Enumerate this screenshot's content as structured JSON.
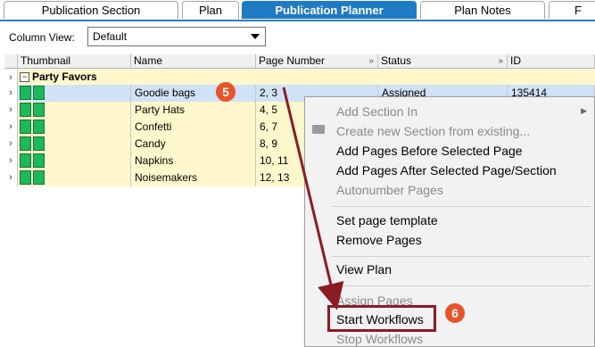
{
  "tabs": [
    {
      "label": "Publication Section",
      "active": false
    },
    {
      "label": "Plan",
      "active": false
    },
    {
      "label": "Publication Planner",
      "active": true
    },
    {
      "label": "Plan Notes",
      "active": false
    },
    {
      "label": "F",
      "active": false
    }
  ],
  "column_view": {
    "label": "Column View:",
    "value": "Default"
  },
  "grid": {
    "headers": [
      "Thumbnail",
      "Name",
      "Page Number",
      "Status",
      "ID"
    ],
    "group": "Party Favors",
    "rows": [
      {
        "name": "Goodie bags",
        "pages": "2, 3",
        "status": "Assigned",
        "id": "135414"
      },
      {
        "name": "Party Hats",
        "pages": "4, 5",
        "status": "",
        "id": ""
      },
      {
        "name": "Confetti",
        "pages": "6, 7",
        "status": "",
        "id": ""
      },
      {
        "name": "Candy",
        "pages": "8, 9",
        "status": "",
        "id": ""
      },
      {
        "name": "Napkins",
        "pages": "10, 11",
        "status": "",
        "id": ""
      },
      {
        "name": "Noisemakers",
        "pages": "12, 13",
        "status": "",
        "id": ""
      }
    ]
  },
  "context_menu": {
    "items": [
      {
        "label": "Add Section In",
        "disabled": true
      },
      {
        "label": "Create new Section from existing...",
        "disabled": true
      },
      {
        "label": "Add Pages Before Selected Page",
        "disabled": false
      },
      {
        "label": "Add Pages After Selected Page/Section",
        "disabled": false
      },
      {
        "label": "Autonumber Pages",
        "disabled": true
      },
      {
        "label": "Set page template",
        "disabled": false
      },
      {
        "label": "Remove Pages",
        "disabled": false
      },
      {
        "label": "View Plan",
        "disabled": false
      },
      {
        "label": "Assign Pages",
        "disabled": true
      },
      {
        "label": "Start Workflows",
        "disabled": false
      },
      {
        "label": "Stop Workflows",
        "disabled": true
      }
    ]
  },
  "callouts": {
    "step5": "5",
    "step6": "6"
  },
  "colors": {
    "accent": "#1f7bc4",
    "highlight_box": "#8b1c26",
    "badge": "#e8542a",
    "thumb": "#1eb85a",
    "row_bg": "#fff8cc",
    "row_selected": "#cfe2f6"
  }
}
